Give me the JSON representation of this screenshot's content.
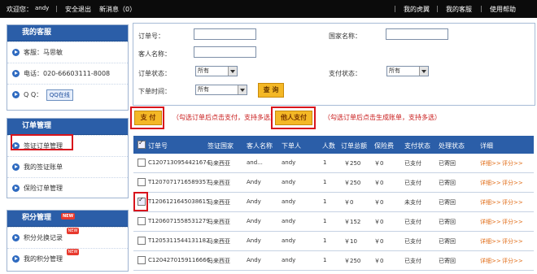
{
  "topbar": {
    "welcome": "欢迎您：",
    "user": "andy",
    "logout": "安全退出",
    "messages": "新消息（0）",
    "links": [
      "我的虎翼",
      "我的客服",
      "使用帮助"
    ]
  },
  "sidebar": {
    "service": {
      "title": "我的客服",
      "name": "客服：马思敏",
      "phone": "电话：020-66603111-8008",
      "qq_label": "Q  Q：",
      "qq_button": "QQ在线"
    },
    "orders": {
      "title": "订单管理",
      "items": [
        "签证订单管理",
        "我的签证账单",
        "保险订单管理"
      ]
    },
    "points": {
      "title": "积分管理",
      "new_tag": "NEW",
      "items": [
        "积分兑换记录",
        "我的积分管理"
      ]
    }
  },
  "search": {
    "order_no_label": "订单号：",
    "country_label": "国家名称：",
    "customer_label": "客人名称：",
    "order_status_label": "订单状态：",
    "order_status_value": "所有",
    "pay_status_label": "支付状态：",
    "pay_status_value": "所有",
    "time_label": "下单时间：",
    "time_value": "所有",
    "query_button": "查 询"
  },
  "actions": {
    "pay_button": "支 付",
    "pay_hint": "（勾选订单后点击支付，支持多选）",
    "personal_pay_button": "他人支付",
    "personal_pay_hint": "（勾选订单后点击生成账单，支持多选）"
  },
  "table": {
    "headers": [
      "订单号",
      "签证国家",
      "客人名称",
      "下单人",
      "人数",
      "订单总额",
      "保险费",
      "支付状态",
      "处理状态",
      "详细"
    ],
    "rows": [
      {
        "checked": false,
        "order": "C1207130954421674",
        "country": "马来西亚",
        "customer": "and...",
        "agent": "andy",
        "count": "1",
        "total": "￥250",
        "insurance": "￥0",
        "pay": "已支付",
        "process": "已寄回",
        "detail": "详细>>",
        "review": "评分>>"
      },
      {
        "checked": false,
        "order": "T1207071716589357",
        "country": "马来西亚",
        "customer": "Andy",
        "agent": "andy",
        "count": "1",
        "total": "￥250",
        "insurance": "￥0",
        "pay": "已支付",
        "process": "已寄回",
        "detail": "详细>>",
        "review": "评分>>"
      },
      {
        "checked": true,
        "order": "T1206121645038615",
        "country": "马来西亚",
        "customer": "Andy",
        "agent": "andy",
        "count": "1",
        "total": "￥0",
        "insurance": "￥0",
        "pay": "未支付",
        "process": "已寄回",
        "detail": "详细>>",
        "review": "评分>>"
      },
      {
        "checked": false,
        "order": "T1206071558531279",
        "country": "马来西亚",
        "customer": "Andy",
        "agent": "andy",
        "count": "1",
        "total": "￥152",
        "insurance": "￥0",
        "pay": "已支付",
        "process": "已寄回",
        "detail": "详细>>",
        "review": "评分>>"
      },
      {
        "checked": false,
        "order": "T1205311544131182",
        "country": "马来西亚",
        "customer": "Andy",
        "agent": "andy",
        "count": "1",
        "total": "￥10",
        "insurance": "￥0",
        "pay": "已支付",
        "process": "已寄回",
        "detail": "详细>>",
        "review": "评分>>"
      },
      {
        "checked": false,
        "order": "C1204270159116666",
        "country": "马来西亚",
        "customer": "Andy",
        "agent": "andy",
        "count": "1",
        "total": "￥250",
        "insurance": "￥0",
        "pay": "已支付",
        "process": "已寄回",
        "detail": "详细>>",
        "review": "评分>>"
      }
    ]
  }
}
